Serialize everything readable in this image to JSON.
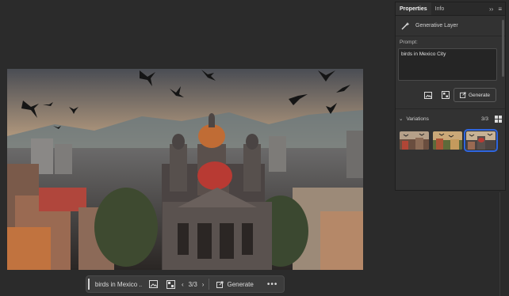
{
  "canvas": {
    "subject": "birds in Mexico City"
  },
  "taskbar": {
    "prompt_text": "birds in Mexico ...",
    "page_indicator": "3/3",
    "generate_label": "Generate",
    "more_label": "•••",
    "icons": [
      "image-icon",
      "remove-bg-icon",
      "chevron-left-icon",
      "chevron-right-icon",
      "generate-icon",
      "more-icon"
    ]
  },
  "panel": {
    "tabs": [
      {
        "label": "Properties",
        "active": true
      },
      {
        "label": "Info",
        "active": false
      }
    ],
    "expand_label": "››",
    "menu_label": "≡",
    "layer_label": "Generative Layer",
    "prompt_label": "Prompt:",
    "prompt_value": "birds in Mexico City",
    "generate_label": "Generate",
    "variations_label": "Variations",
    "variations_count": "3/3",
    "selected_variation": 3
  },
  "colors": {
    "accent": "#2f66e0",
    "panel_bg": "#323232",
    "workspace_bg": "#2b2b2b"
  }
}
